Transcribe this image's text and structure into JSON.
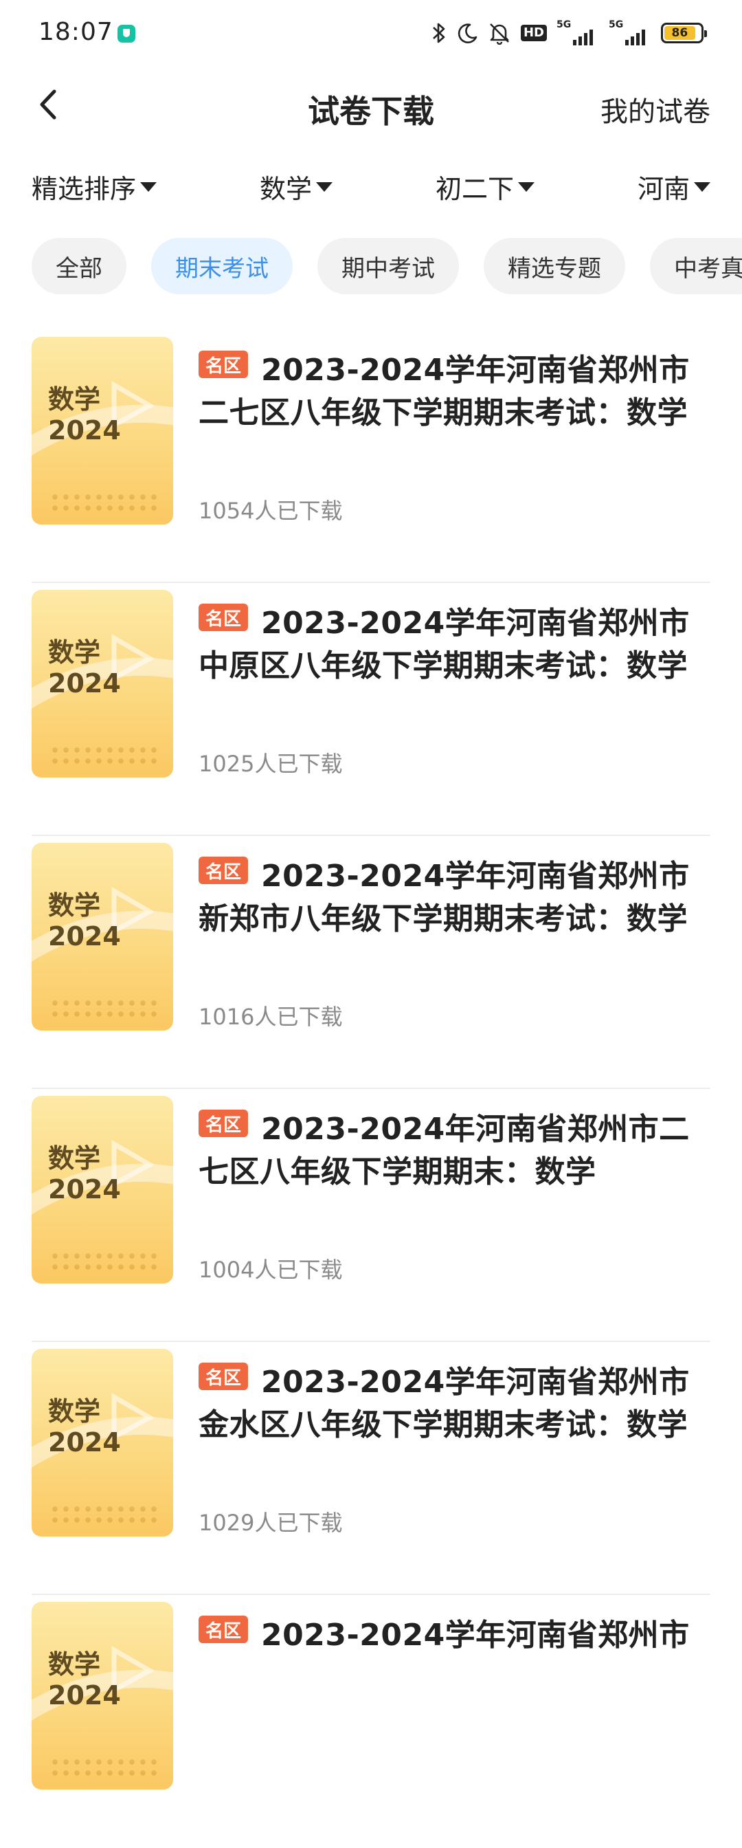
{
  "status_bar": {
    "time": "18:07",
    "hd_label": "HD",
    "net_1": "5G",
    "net_2": "5G",
    "battery": "86"
  },
  "nav": {
    "title": "试卷下载",
    "right_action": "我的试卷"
  },
  "filters": [
    {
      "label": "精选排序"
    },
    {
      "label": "数学"
    },
    {
      "label": "初二下"
    },
    {
      "label": "河南"
    }
  ],
  "chips": [
    {
      "label": "全部",
      "active": false
    },
    {
      "label": "期末考试",
      "active": true
    },
    {
      "label": "期中考试",
      "active": false
    },
    {
      "label": "精选专题",
      "active": false
    },
    {
      "label": "中考真题",
      "active": false
    }
  ],
  "items": [
    {
      "cover_subject": "数学",
      "cover_year": "2024",
      "tag": "名区",
      "title_line1": "2023-2024学年河南省郑州市",
      "title_line2": "二七区八年级下学期期末考试：数学",
      "downloads": "1054人已下载"
    },
    {
      "cover_subject": "数学",
      "cover_year": "2024",
      "tag": "名区",
      "title_line1": "2023-2024学年河南省郑州市",
      "title_line2": "中原区八年级下学期期末考试：数学",
      "downloads": "1025人已下载"
    },
    {
      "cover_subject": "数学",
      "cover_year": "2024",
      "tag": "名区",
      "title_line1": "2023-2024学年河南省郑州市",
      "title_line2": "新郑市八年级下学期期末考试：数学",
      "downloads": "1016人已下载"
    },
    {
      "cover_subject": "数学",
      "cover_year": "2024",
      "tag": "名区",
      "title_line1": "2023-2024年河南省郑州市二",
      "title_line2": "七区八年级下学期期末：数学",
      "downloads": "1004人已下载"
    },
    {
      "cover_subject": "数学",
      "cover_year": "2024",
      "tag": "名区",
      "title_line1": "2023-2024学年河南省郑州市",
      "title_line2": "金水区八年级下学期期末考试：数学",
      "downloads": "1029人已下载"
    },
    {
      "cover_subject": "数学",
      "cover_year": "2024",
      "tag": "名区",
      "title_line1": "2023-2024学年河南省郑州市",
      "title_line2": "",
      "downloads": ""
    }
  ]
}
